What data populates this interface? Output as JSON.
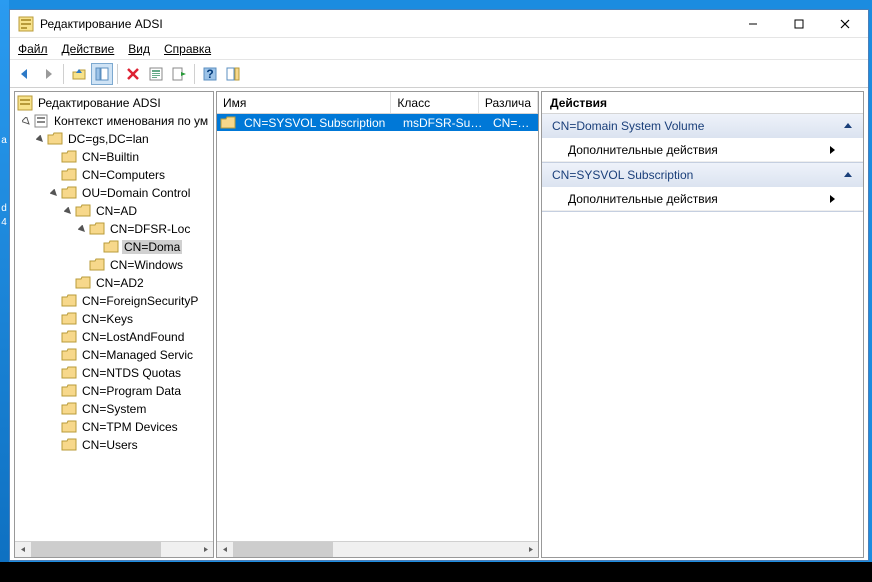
{
  "window": {
    "title": "Редактирование ADSI",
    "minimize": "—",
    "maximize": "☐",
    "close": "✕"
  },
  "menu": {
    "file": "Файл",
    "action": "Действие",
    "view": "Вид",
    "help": "Справка"
  },
  "tree": {
    "root": "Редактирование ADSI",
    "ctx": "Контекст именования по ум",
    "dc": "DC=gs,DC=lan",
    "builtin": "CN=Builtin",
    "computers": "CN=Computers",
    "ou": "OU=Domain Control",
    "ad": "CN=AD",
    "dfsr": "CN=DFSR-Loc",
    "doma": "CN=Doma",
    "windows": "CN=Windows",
    "ad2": "CN=AD2",
    "fsp": "CN=ForeignSecurityP",
    "keys": "CN=Keys",
    "laf": "CN=LostAndFound",
    "msc": "CN=Managed Servic",
    "ntds": "CN=NTDS Quotas",
    "pdata": "CN=Program Data",
    "system": "CN=System",
    "tpm": "CN=TPM Devices",
    "users": "CN=Users"
  },
  "list": {
    "headers": {
      "name": "Имя",
      "class": "Класс",
      "dn": "Различа"
    },
    "row": {
      "name": "CN=SYSVOL Subscription",
      "class": "msDFSR-Sub...",
      "dn": "CN=SYS"
    }
  },
  "actions": {
    "title": "Действия",
    "group1": "CN=Domain System Volume",
    "group2": "CN=SYSVOL Subscription",
    "more": "Дополнительные действия"
  },
  "side": {
    "a": "а",
    "d": "d",
    "n4": "4"
  }
}
